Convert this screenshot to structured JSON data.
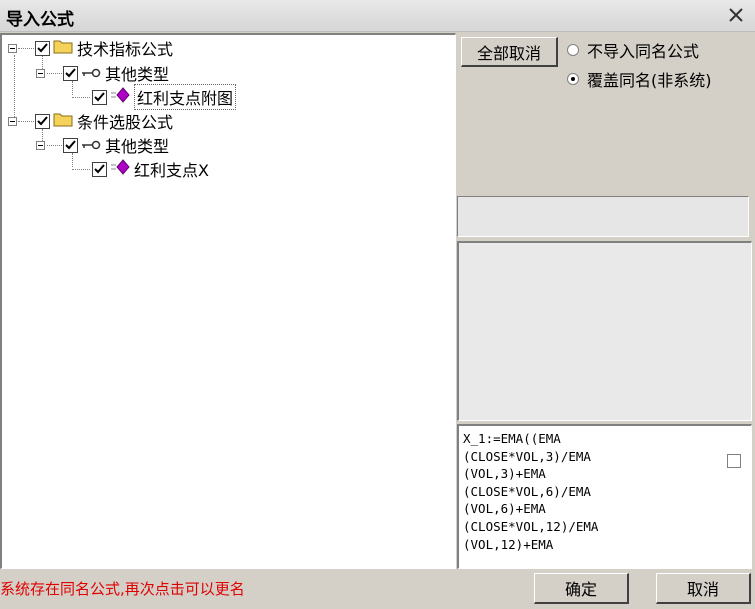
{
  "window": {
    "title": "导入公式"
  },
  "tree": {
    "nodes": [
      {
        "label": "技术指标公式",
        "icon": "folder-icon",
        "checked": true,
        "expanded": true
      },
      {
        "label": "其他类型",
        "icon": "key-icon",
        "checked": true,
        "expanded": true
      },
      {
        "label": "红利支点附图",
        "icon": "formula-icon",
        "checked": true,
        "selected": true
      },
      {
        "label": "条件选股公式",
        "icon": "folder-icon",
        "checked": true,
        "expanded": true
      },
      {
        "label": "其他类型",
        "icon": "key-icon",
        "checked": true,
        "expanded": true
      },
      {
        "label": "红利支点X",
        "icon": "formula-icon",
        "checked": true
      }
    ]
  },
  "toolbar": {
    "deselect_all_label": "全部取消"
  },
  "options": {
    "skip_same_name": {
      "label": "不导入同名公式",
      "selected": false
    },
    "overwrite_same_name": {
      "label": "覆盖同名(非系统)",
      "selected": true
    }
  },
  "code": {
    "text": "X_1:=EMA((EMA\n(CLOSE*VOL,3)/EMA\n(VOL,3)+EMA\n(CLOSE*VOL,6)/EMA\n(VOL,6)+EMA\n(CLOSE*VOL,12)/EMA\n(VOL,12)+EMA"
  },
  "status": {
    "message": "系统存在同名公式,再次点击可以更名",
    "color": "#e00000"
  },
  "buttons": {
    "ok_label": "确定",
    "cancel_label": "取消"
  },
  "colors": {
    "dialog_bg": "#d4d0c8",
    "folder": "#f5d25a",
    "formula": "#b000c8"
  }
}
